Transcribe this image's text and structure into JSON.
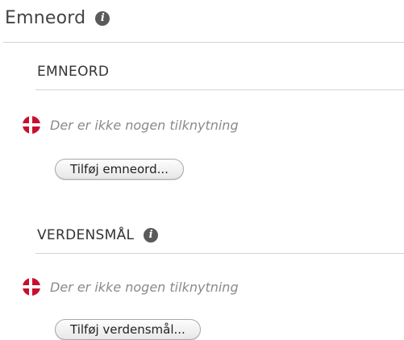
{
  "panel": {
    "title": "Emneord",
    "info_icon": "info-icon"
  },
  "sections": [
    {
      "heading": "EMNEORD",
      "has_info": false,
      "empty_text": "Der er ikke nogen tilknytning",
      "flag_icon": "danish-flag-icon",
      "button_label": "Tilføj emneord..."
    },
    {
      "heading": "VERDENSMÅL",
      "has_info": true,
      "info_icon": "info-icon",
      "empty_text": "Der er ikke nogen tilknytning",
      "flag_icon": "danish-flag-icon",
      "button_label": "Tilføj verdensmål..."
    }
  ],
  "colors": {
    "flag_red": "#c8102e",
    "empty_text": "#8a8a8a",
    "rule": "#d4d4d4"
  }
}
